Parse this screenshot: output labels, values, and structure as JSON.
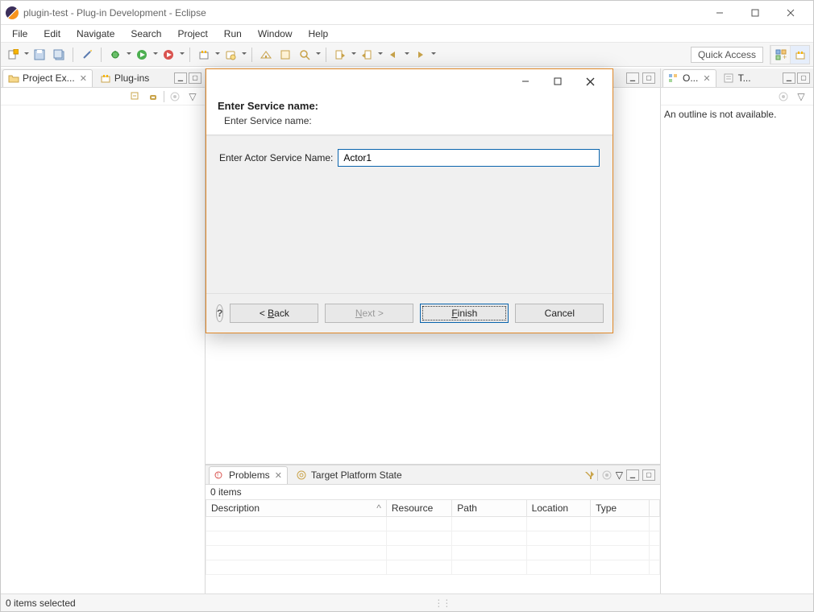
{
  "window": {
    "title": "plugin-test - Plug-in Development - Eclipse"
  },
  "menu": [
    "File",
    "Edit",
    "Navigate",
    "Search",
    "Project",
    "Run",
    "Window",
    "Help"
  ],
  "toolbar": {
    "quick_access": "Quick Access"
  },
  "left": {
    "tabs": [
      {
        "label": "Project Ex...",
        "active": true
      },
      {
        "label": "Plug-ins",
        "active": false
      }
    ]
  },
  "right": {
    "tabs": [
      {
        "label": "O...",
        "name": "outline",
        "active": true
      },
      {
        "label": "T...",
        "name": "tasklist",
        "active": false
      }
    ],
    "outline_msg": "An outline is not available."
  },
  "bottom": {
    "tabs": [
      {
        "label": "Problems",
        "active": true
      },
      {
        "label": "Target Platform State",
        "active": false
      }
    ],
    "items_label": "0 items",
    "columns": [
      "Description",
      "Resource",
      "Path",
      "Location",
      "Type"
    ]
  },
  "statusbar": {
    "text": "0 items selected"
  },
  "dialog": {
    "header": "Enter Service name:",
    "sub": "Enter Service name:",
    "field_label": "Enter Actor Service Name:",
    "field_value": "Actor1",
    "buttons": {
      "back": "< Back",
      "next": "Next >",
      "finish": "Finish",
      "cancel": "Cancel"
    }
  }
}
